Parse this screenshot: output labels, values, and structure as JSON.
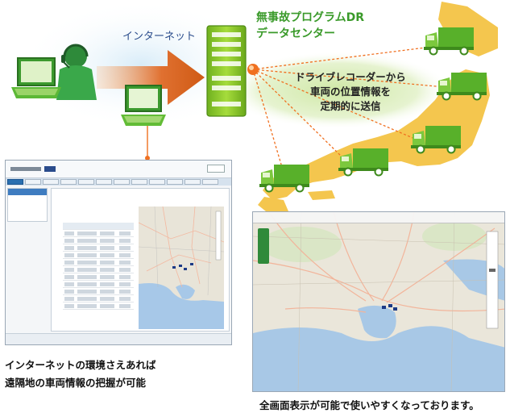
{
  "diagram": {
    "internet_label": "インターネット",
    "center_title_line1": "無事故プログラムDR",
    "center_title_line2": "データセンター",
    "message_lines": [
      "ドライブレコーダーから",
      "車両の位置情報を",
      "定期的に送信"
    ],
    "caption_left_lines": [
      "インターネットの環境さえあれば",
      "遠隔地の車両情報の把握が可能"
    ],
    "caption_right": "全画面表示が可能で使いやすくなっております。"
  },
  "colors": {
    "arrow": "#d9641c",
    "server": "#8ccc2a",
    "computer": "#7ab828",
    "truck": "#64b82a",
    "japan_map": "#f4c64e",
    "glow": "#c6e3a4",
    "signal_dot": "#f07020",
    "text_green": "#3a9a2a",
    "text_blue": "#2a4c8c"
  },
  "icons": {
    "operator": "headset-operator-icon",
    "laptop": "laptop-icon",
    "server": "server-icon",
    "truck": "truck-icon",
    "map": "japan-map-icon"
  }
}
